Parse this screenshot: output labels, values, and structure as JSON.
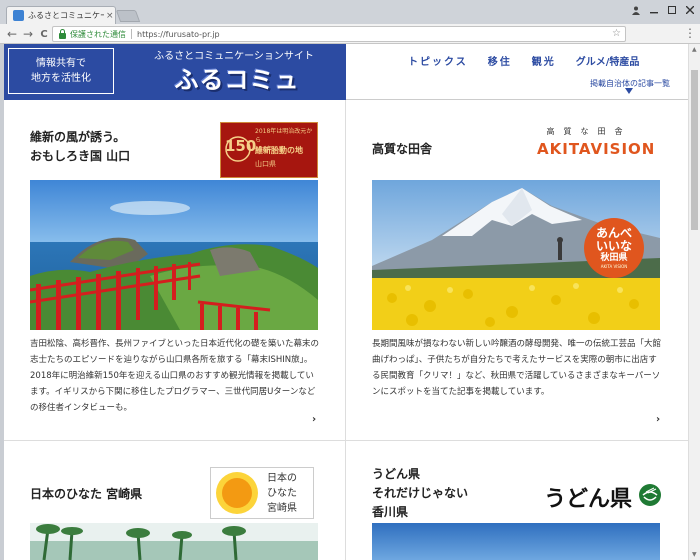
{
  "browser": {
    "tab_title": "ふるさとコミュニケーシ",
    "tab_close": "×",
    "secure_label": "保護された通信",
    "url": "https://furusato-pr.jp",
    "back": "←",
    "forward": "→",
    "reload": "C",
    "star": "☆",
    "menu": "⋮",
    "window_controls": [
      "👤",
      "—",
      "▢",
      "✕"
    ]
  },
  "header": {
    "mission_line1": "情報共有で",
    "mission_line2": "地方を活性化",
    "tagline": "ふるさとコミュニケーションサイト",
    "logo": "ふるコミュ",
    "nav": [
      "トピックス",
      "移住",
      "観光",
      "グルメ/特産品"
    ],
    "all_cities": "掲載自治体の記事一覧",
    "colors": {
      "brand": "#2c4ba2",
      "accent": "#e0561e"
    }
  },
  "cards": {
    "yamaguchi": {
      "title_line1": "維新の風が誘う。",
      "title_line2": "おもしろき国 山口",
      "badge_num": "150",
      "badge_line1": "2018年は明治改元から",
      "badge_line1b": "150年です",
      "badge_line2": "維新胎動の地",
      "badge_line3": "山口県",
      "desc": "吉田松陰、高杉晋作、長州ファイブといった日本近代化の礎を築いた幕末の志士たちのエピソードを辿りながら山口県各所を旅する「幕末ISHIN旅」。2018年に明治維新150年を迎える山口県のおすすめ観光情報を掲載しています。イギリスから下関に移住したプログラマー、三世代同居Uターンなどの移住者インタビューも。",
      "chevron": "›"
    },
    "akita": {
      "title": "高質な田舎",
      "logo_sub": "高質な田舎",
      "logo": "AKITAVISION",
      "badge_line1": "あんべ",
      "badge_line2": "いいな",
      "badge_line3": "秋田県",
      "badge_small": "AKITA VISION",
      "desc": "長期間風味が損なわない新しい吟醸酒の酵母開発、唯一の伝統工芸品「大館曲げわっぱ」、子供たちが自分たちで考えたサービスを実際の朝市に出店する民間教育「クリマ！」など、秋田県で活躍しているさまざまなキーパーソンにスポットを当てた記事を掲載しています。",
      "chevron": "›"
    },
    "miyazaki": {
      "title": "日本のひなた 宮崎県",
      "badge_text": "日本の ひなた 宮崎県",
      "badge_lines": [
        "日本の",
        "ひなた",
        "宮崎県"
      ]
    },
    "kagawa": {
      "title_line1": "うどん県",
      "title_line2": "それだけじゃない",
      "title_line3": "香川県",
      "logo": "うどん県"
    }
  }
}
